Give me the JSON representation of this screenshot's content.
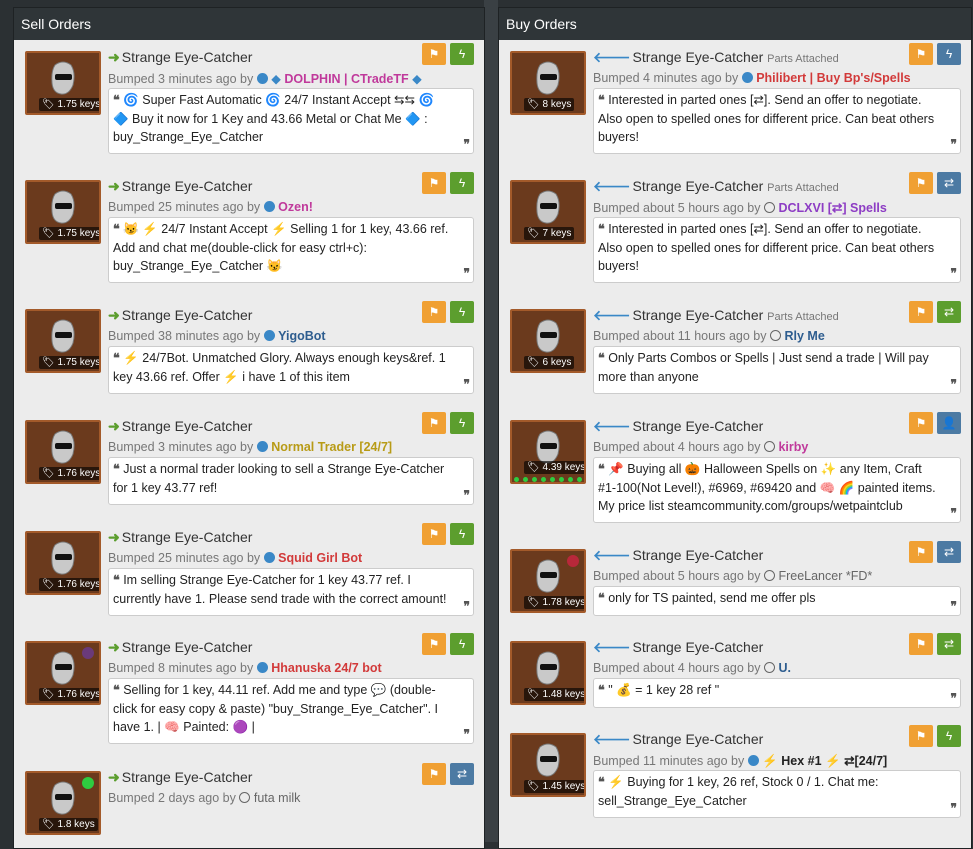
{
  "sell": {
    "header": "Sell Orders",
    "items": [
      {
        "title": "Strange Eye-Catcher",
        "price": "1.75 keys",
        "bumped": "Bumped 3 minutes ago by",
        "user": "DOLPHIN | CTradeTF",
        "desc": "🌀 Super Fast Automatic 🌀 24/7 Instant Accept ⇆⇆ 🌀 🔷 Buy it now for 1 Key and 43.66 Metal or Chat Me 🔷 : buy_Strange_Eye_Catcher"
      },
      {
        "title": "Strange Eye-Catcher",
        "price": "1.75 keys",
        "bumped": "Bumped 25 minutes ago by",
        "user": "Ozen!",
        "desc": "😼 ⚡ 24/7 Instant Accept ⚡ Selling 1 for 1 key, 43.66 ref. Add and chat me(double-click for easy ctrl+c): buy_Strange_Eye_Catcher 😼"
      },
      {
        "title": "Strange Eye-Catcher",
        "price": "1.75 keys",
        "bumped": "Bumped 38 minutes ago by",
        "user": "YigoBot",
        "desc": "⚡ 24/7Bot. Unmatched Glory. Always enough keys&ref. 1 key 43.66 ref. Offer ⚡ i have 1 of this item"
      },
      {
        "title": "Strange Eye-Catcher",
        "price": "1.76 keys",
        "bumped": "Bumped 3 minutes ago by",
        "user": "Normal Trader [24/7]",
        "desc": "Just a normal trader looking to sell a Strange Eye-Catcher for 1 key 43.77 ref!"
      },
      {
        "title": "Strange Eye-Catcher",
        "price": "1.76 keys",
        "bumped": "Bumped 25 minutes ago by",
        "user": "Squid Girl Bot",
        "desc": "Im selling Strange Eye-Catcher for 1 key 43.77 ref. I currently have 1. Please send trade with the correct amount!"
      },
      {
        "title": "Strange Eye-Catcher",
        "price": "1.76 keys",
        "bumped": "Bumped 8 minutes ago by",
        "user": "Hhanuska 24/7 bot",
        "desc": "Selling for 1 key, 44.11 ref. Add me and type 💬 (double-click for easy copy & paste) \"buy_Strange_Eye_Catcher\". I have 1. | 🧠 Painted: 🟣 |"
      },
      {
        "title": "Strange Eye-Catcher",
        "price": "1.8 keys",
        "bumped": "Bumped 2 days ago by",
        "user": "futa milk",
        "desc": ""
      }
    ]
  },
  "buy": {
    "header": "Buy Orders",
    "parts_attached": "Parts Attached",
    "items": [
      {
        "title": "Strange Eye-Catcher",
        "price": "8 keys",
        "bumped": "Bumped 4 minutes ago by",
        "user": "Philibert | Buy Bp's/Spells",
        "desc": "Interested in parted ones [⇄]. Send an offer to negotiate. Also open to spelled ones for different price. Can beat others buyers!"
      },
      {
        "title": "Strange Eye-Catcher",
        "price": "7 keys",
        "bumped": "Bumped about 5 hours ago by",
        "user": "DCLXVI [⇄] Spells",
        "desc": "Interested in parted ones [⇄]. Send an offer to negotiate. Also open to spelled ones for different price. Can beat others buyers!"
      },
      {
        "title": "Strange Eye-Catcher",
        "price": "6 keys",
        "bumped": "Bumped about 11 hours ago by",
        "user": "Rly Me",
        "desc": "Only Parts Combos or Spells | Just send a trade | Will pay more than anyone"
      },
      {
        "title": "Strange Eye-Catcher",
        "price": "4.39 keys",
        "bumped": "Bumped about 4 hours ago by",
        "user": "kirby",
        "desc": "📌 Buying all 🎃 Halloween Spells on ✨ any Item, Craft #1-100(Not Level!), #6969, #69420 and 🧠 🌈 painted items. My price list steamcommunity.com/groups/wetpaintclub"
      },
      {
        "title": "Strange Eye-Catcher",
        "price": "1.78 keys",
        "bumped": "Bumped about 5 hours ago by",
        "user": "FreeLancer *FD*",
        "desc": "only for TS painted, send me offer pls"
      },
      {
        "title": "Strange Eye-Catcher",
        "price": "1.48 keys",
        "bumped": "Bumped about 4 hours ago by",
        "user": "U.",
        "desc": "\" 💰 = 1 key 28 ref \""
      },
      {
        "title": "Strange Eye-Catcher",
        "price": "1.45 keys",
        "bumped": "Bumped 11 minutes ago by",
        "user": "⚡ Hex #1 ⚡ ⇄[24/7]",
        "desc": "⚡ Buying for 1 key, 26 ref, Stock 0 / 1. Chat me: sell_Strange_Eye_Catcher"
      }
    ]
  },
  "icons": {
    "flag": "flag-icon",
    "bolt": "lightning-icon",
    "swap": "exchange-icon",
    "add_friend": "add-friend-icon",
    "quote_open": "quote-open-icon",
    "quote_close": "quote-close-icon"
  },
  "colors": {
    "flag": "#f0a033",
    "bolt": "#5c9e2e",
    "swap_blue": "#4c7aa3",
    "panel_header": "#2f3538"
  }
}
